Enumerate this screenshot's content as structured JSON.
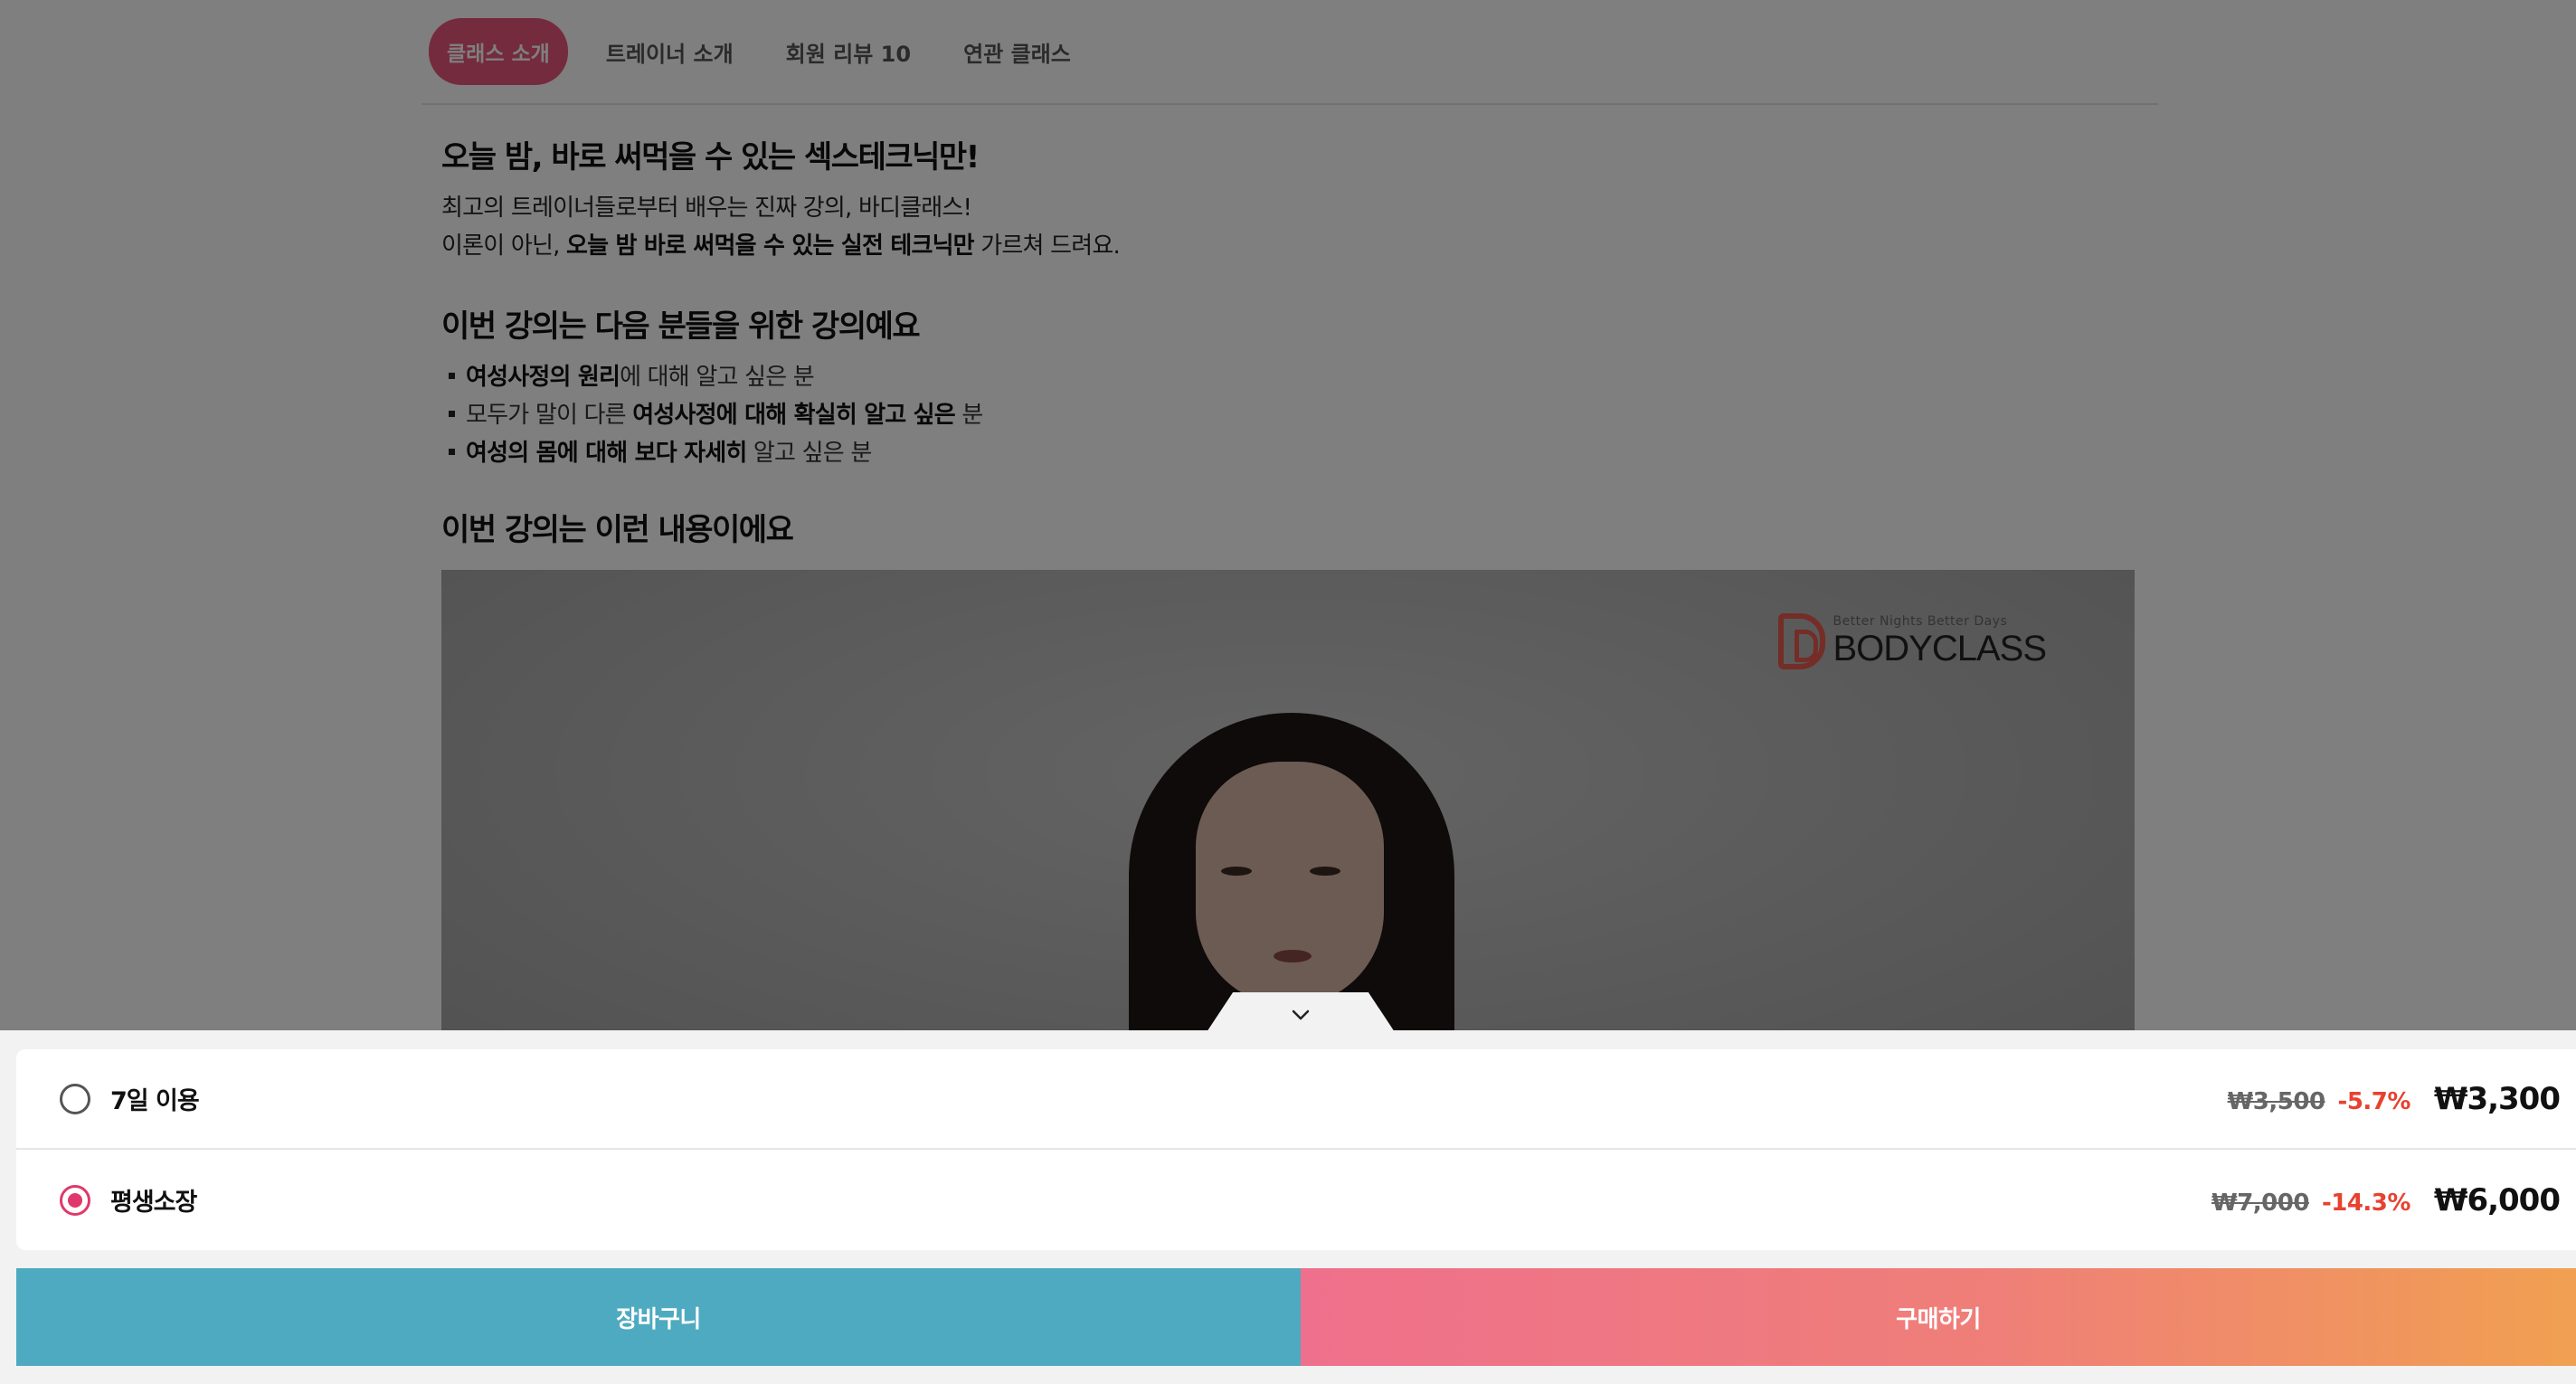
{
  "tabs": [
    {
      "label": "클래스 소개",
      "active": true
    },
    {
      "label": "트레이너 소개",
      "active": false
    },
    {
      "label": "회원 리뷰 10",
      "active": false
    },
    {
      "label": "연관 클래스",
      "active": false
    }
  ],
  "article": {
    "heading1": "오늘 밤, 바로 써먹을 수 있는 섹스테크닉만!",
    "intro_line1": "최고의 트레이너들로부터 배우는 진짜 강의, 바디클래스!",
    "intro_line2_pre": "이론이 아닌, ",
    "intro_line2_bold": "오늘 밤 바로 써먹을 수 있는 실전 테크닉만",
    "intro_line2_post": " 가르쳐 드려요.",
    "heading2": "이번 강의는 다음 분들을 위한 강의예요",
    "bullets": [
      {
        "pre": "",
        "bold": "여성사정의 원리",
        "post": "에 대해 알고 싶은 분"
      },
      {
        "pre": "모두가 말이 다른 ",
        "bold": "여성사정에 대해 확실히 알고 싶은",
        "post": " 분"
      },
      {
        "pre": "",
        "bold": "여성의 몸에 대해 보다 자세히",
        "post": " 알고 싶은 분"
      }
    ],
    "heading3": "이번 강의는 이런 내용이에요"
  },
  "video": {
    "logo_tagline": "Better Nights Better Days",
    "logo_name": "BODYCLASS"
  },
  "purchase": {
    "options": [
      {
        "label": "7일 이용",
        "original_price": "₩3,500",
        "discount": "-5.7%",
        "price": "₩3,300",
        "selected": false
      },
      {
        "label": "평생소장",
        "original_price": "₩7,000",
        "discount": "-14.3%",
        "price": "₩6,000",
        "selected": true
      }
    ],
    "cart_label": "장바구니",
    "buy_label": "구매하기"
  },
  "colors": {
    "accent_pink": "#e9577a",
    "cart_blue": "#4eaac0",
    "discount_red": "#e8412f"
  }
}
